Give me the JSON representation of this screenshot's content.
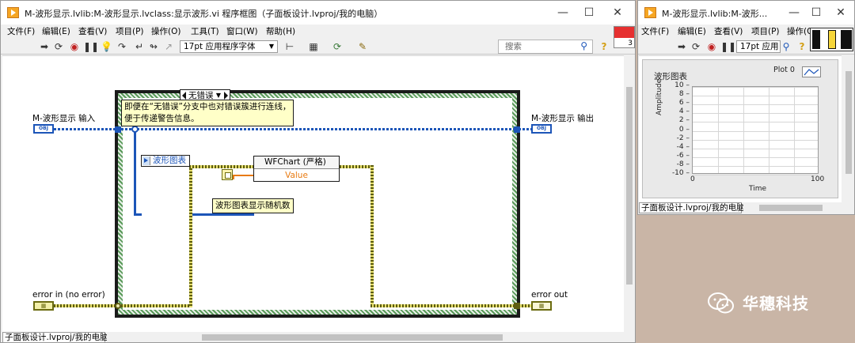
{
  "block_diagram": {
    "title": "M-波形显示.lvlib:M-波形显示.lvclass:显示波形.vi 程序框图（子面板设计.lvproj/我的电脑）",
    "menu": [
      "文件(F)",
      "编辑(E)",
      "查看(V)",
      "项目(P)",
      "操作(O)",
      "工具(T)",
      "窗口(W)",
      "帮助(H)"
    ],
    "font_select": "17pt 应用程序字体",
    "search_placeholder": "搜索",
    "connector_number": "3",
    "case_selector": "无错误",
    "comment": {
      "line1": "即便在“无错误”分支中也对错误簇进行连线，",
      "line2": "便于传递警告信息。"
    },
    "input_label": "M-波形显示 输入",
    "output_label": "M-波形显示 输出",
    "obj_tag": "OBJ",
    "error_in_label": "error in (no error)",
    "error_out_label": "error out",
    "ref_label": "波形图表",
    "property_node": {
      "header": "WFChart (严格)",
      "row": "Value"
    },
    "random_label": "波形图表显示随机数",
    "status": "子面板设计.lvproj/我的电脑"
  },
  "front_panel": {
    "title": "M-波形显示.lvlib:M-波形...",
    "menu": [
      "文件(F)",
      "编辑(E)",
      "查看(V)",
      "项目(P)",
      "操作(O)"
    ],
    "font_select": "17pt 应用",
    "status": "子面板设计.lvproj/我的电脑"
  },
  "chart_data": {
    "type": "line",
    "title": "波形图表",
    "legend": "Plot 0",
    "xlabel": "Time",
    "ylabel": "Amplitude",
    "xlim": [
      0,
      100
    ],
    "ylim": [
      -10,
      10
    ],
    "x_ticks": [
      "0",
      "100"
    ],
    "y_ticks": [
      "10",
      "8",
      "6",
      "4",
      "2",
      "0",
      "-2",
      "-4",
      "-6",
      "-8",
      "-10"
    ],
    "series": []
  },
  "desktop": {
    "brand": "华穗科技"
  }
}
